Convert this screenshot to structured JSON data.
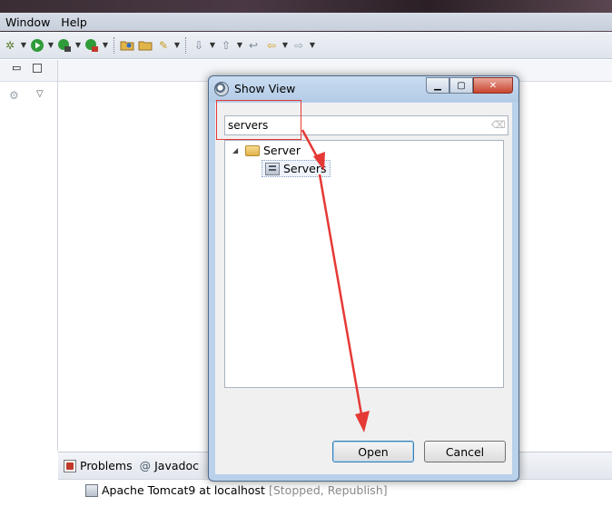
{
  "menu": {
    "items": [
      "Window",
      "Help"
    ]
  },
  "dialog": {
    "title": "Show View",
    "filter": {
      "value": "servers"
    },
    "tree": {
      "folder_label": "Server",
      "child_label": "Servers"
    },
    "buttons": {
      "open": "Open",
      "cancel": "Cancel"
    }
  },
  "bottom": {
    "tabs": [
      "Problems",
      "Javadoc"
    ],
    "server_row": {
      "name": "Apache Tomcat9 at localhost",
      "status": "[Stopped, Republish]"
    }
  },
  "colors": {
    "highlight": "#e53935",
    "dialog_frame": "#b9d1ea",
    "close_button": "#c9452f"
  }
}
